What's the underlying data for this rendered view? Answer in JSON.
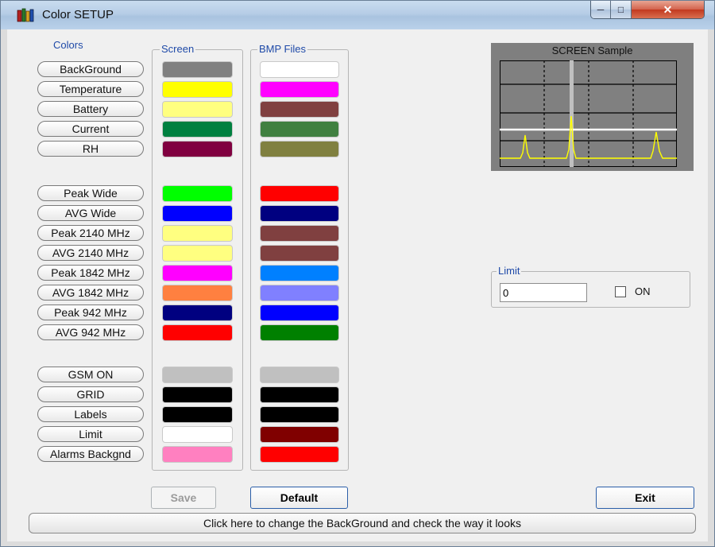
{
  "window": {
    "title": "Color SETUP",
    "icon": "books-icon"
  },
  "colors_label": "Colors",
  "screen_group_title": "Screen",
  "bmp_group_title": "BMP Files",
  "items": [
    {
      "label": "BackGround",
      "screen": "#808080",
      "bmp": "#ffffff"
    },
    {
      "label": "Temperature",
      "screen": "#ffff00",
      "bmp": "#ff00ff"
    },
    {
      "label": "Battery",
      "screen": "#ffff80",
      "bmp": "#804040"
    },
    {
      "label": "Current",
      "screen": "#008040",
      "bmp": "#408040"
    },
    {
      "label": "RH",
      "screen": "#800040",
      "bmp": "#808040"
    },
    {
      "label": "Peak Wide",
      "screen": "#00ff00",
      "bmp": "#ff0000"
    },
    {
      "label": "AVG  Wide",
      "screen": "#0000ff",
      "bmp": "#000080"
    },
    {
      "label": "Peak 2140 MHz",
      "screen": "#ffff80",
      "bmp": "#804040"
    },
    {
      "label": "AVG  2140 MHz",
      "screen": "#ffff80",
      "bmp": "#804040"
    },
    {
      "label": "Peak 1842 MHz",
      "screen": "#ff00ff",
      "bmp": "#0080ff"
    },
    {
      "label": "AVG  1842 MHz",
      "screen": "#ff8040",
      "bmp": "#8080ff"
    },
    {
      "label": "Peak 942 MHz",
      "screen": "#000080",
      "bmp": "#0000ff"
    },
    {
      "label": "AVG  942 MHz",
      "screen": "#ff0000",
      "bmp": "#008000"
    },
    {
      "label": "GSM ON",
      "screen": "#c0c0c0",
      "bmp": "#c0c0c0"
    },
    {
      "label": "GRID",
      "screen": "#000000",
      "bmp": "#000000"
    },
    {
      "label": "Labels",
      "screen": "#000000",
      "bmp": "#000000"
    },
    {
      "label": "Limit",
      "screen": "#ffffff",
      "bmp": "#800000"
    },
    {
      "label": "Alarms Backgnd",
      "screen": "#ff80c0",
      "bmp": "#ff0000"
    }
  ],
  "sample": {
    "title": "SCREEN Sample"
  },
  "limit": {
    "group_title": "Limit",
    "value": "0",
    "checkbox_label": "ON",
    "checked": false
  },
  "buttons": {
    "save": "Save",
    "default": "Default",
    "exit": "Exit"
  },
  "status_text": "Click here to change the BackGround and check the way it looks"
}
